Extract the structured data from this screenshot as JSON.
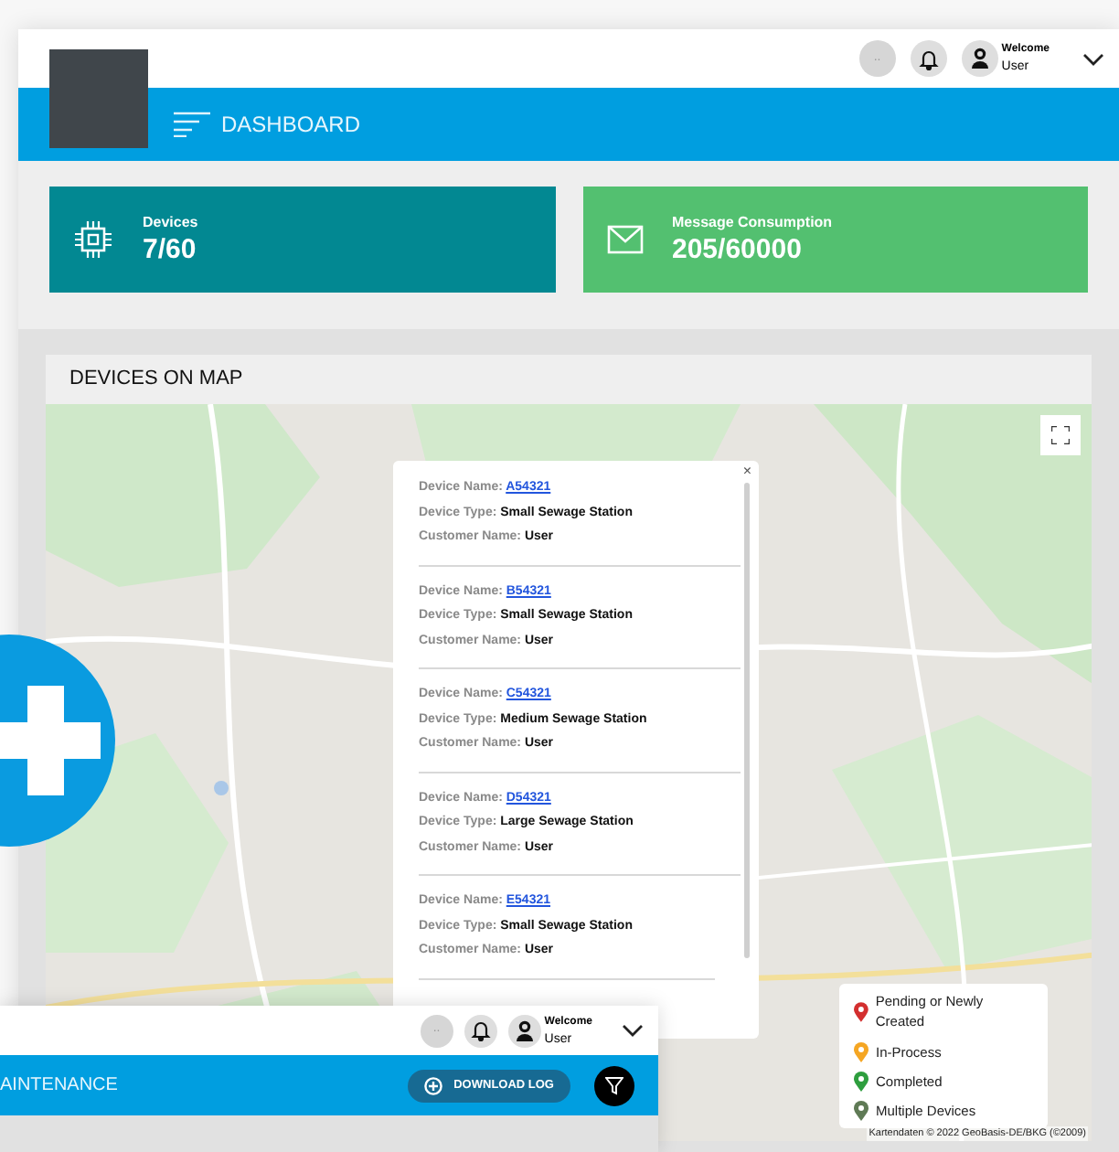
{
  "header": {
    "status_dots": "..",
    "greeting": "Welcome",
    "user": "User"
  },
  "nav": {
    "title": "DASHBOARD"
  },
  "stats": [
    {
      "kind": "chip",
      "label": "Devices",
      "value": "7/60",
      "color": "#028892"
    },
    {
      "kind": "mail",
      "label": "Message Consumption",
      "value": "205/60000",
      "color": "#53c070"
    }
  ],
  "map_panel": {
    "title": "DEVICES ON MAP",
    "popup": {
      "close": "×",
      "devices": [
        {
          "name_label": "Device Name:",
          "name": "A54321",
          "type_label": "Device Type:",
          "type": "Small Sewage Station",
          "customer_label": "Customer Name:",
          "customer": "User"
        },
        {
          "name_label": "Device Name:",
          "name": "B54321",
          "type_label": "Device Type:",
          "type": "Small Sewage Station",
          "customer_label": "Customer Name:",
          "customer": "User"
        },
        {
          "name_label": "Device Name:",
          "name": "C54321",
          "type_label": "Device Type:",
          "type": "Medium Sewage Station",
          "customer_label": "Customer Name:",
          "customer": "User"
        },
        {
          "name_label": "Device Name:",
          "name": "D54321",
          "type_label": "Device Type:",
          "type": "Large Sewage Station",
          "customer_label": "Customer Name:",
          "customer": "User"
        },
        {
          "name_label": "Device Name:",
          "name": "E54321",
          "type_label": "Device Type:",
          "type": "Small Sewage Station",
          "customer_label": "Customer Name:",
          "customer": "User"
        }
      ]
    },
    "legend": [
      {
        "label": "Pending or Newly Created",
        "color": "#d32f2f"
      },
      {
        "label": "In-Process",
        "color": "#f5a623"
      },
      {
        "label": "Completed",
        "color": "#2e9e3e"
      },
      {
        "label": "Multiple Devices",
        "color": "#5f7a55"
      }
    ],
    "attribution": "Kartendaten © 2022 GeoBasis-DE/BKG (©2009)"
  },
  "second_window": {
    "header": {
      "status_dots": "..",
      "greeting": "Welcome",
      "user": "User"
    },
    "nav": {
      "title": "AINTENANCE"
    },
    "download_button": "DOWNLOAD LOG"
  }
}
